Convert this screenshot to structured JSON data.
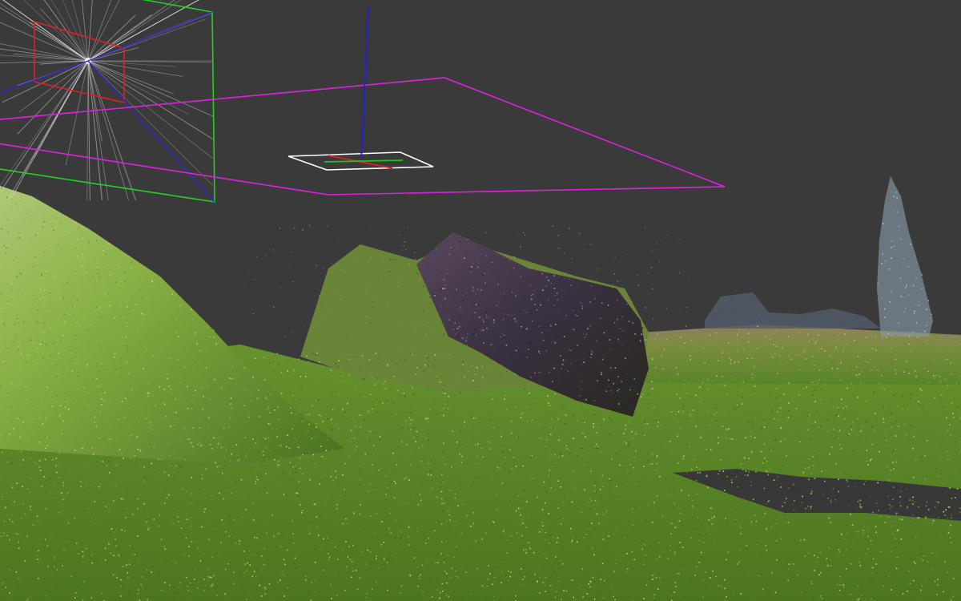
{
  "viewer": {
    "background_color": "#3a3a3a"
  },
  "camera_frustum": {
    "icon": "camera-frustum-icon",
    "near_plane_color": "#e02020",
    "far_plane_color": "#22d022",
    "edge_color": "#2a2ad0",
    "ray_color": "#d8d8d8"
  },
  "view_frustum": {
    "icon": "view-frustum-icon",
    "color": "#e020e0"
  },
  "origin_axes": {
    "icon": "axis-gizmo-icon",
    "x_color": "#e02020",
    "y_color": "#20c020",
    "z_color": "#2020e0",
    "plane_color": "#ffffff"
  },
  "point_cloud": {
    "grass_colors": [
      "#3f6b1f",
      "#557f27",
      "#6a9630",
      "#7fa93b",
      "#98bf4c",
      "#b6cf77"
    ],
    "rock_colors": [
      "#2c2430",
      "#3d3448",
      "#51445c",
      "#6a5b70",
      "#8a7a84",
      "#a59a93"
    ],
    "dry_grass_colors": [
      "#8f7f5f",
      "#a08e6b",
      "#b19e7a",
      "#c1b08b"
    ],
    "sky_edge_colors": [
      "#697f95",
      "#88a2b5",
      "#a7bdc8"
    ]
  }
}
